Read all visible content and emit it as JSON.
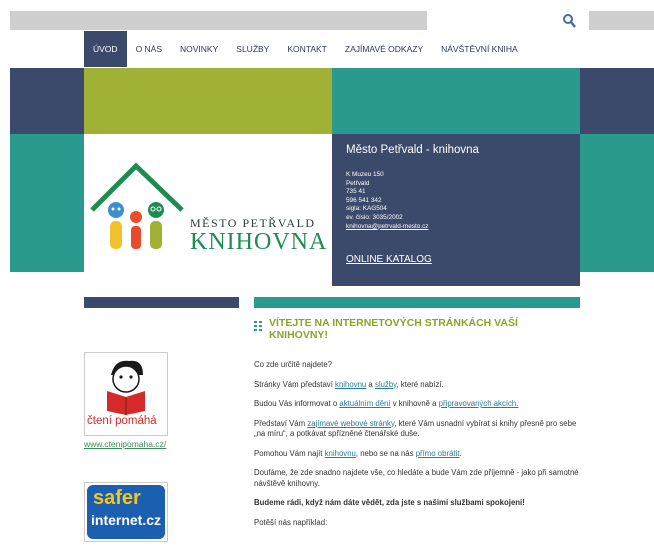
{
  "nav": {
    "items": [
      {
        "label": "ÚVOD",
        "active": true
      },
      {
        "label": "O NÁS"
      },
      {
        "label": "NOVINKY"
      },
      {
        "label": "SLUŽBY"
      },
      {
        "label": "KONTAKT"
      },
      {
        "label": "ZAJÍMAVÉ ODKAZY"
      },
      {
        "label": "NÁVŠTĚVNÍ KNIHA"
      }
    ]
  },
  "search": {
    "placeholder": ""
  },
  "logo": {
    "title": "MĚSTO PETŘVALD",
    "subtitle": "KNIHOVNA"
  },
  "info": {
    "name": "Město Petřvald - knihovna",
    "street": "K Muzeu 150",
    "city": "Petřvald",
    "zip": "735 41",
    "phone": "596 541 342",
    "sigla": "sigla: KAG504",
    "ev": "ev. číslo: 3035/2002",
    "email": "knihovna@petrvald-mesto.cz",
    "katalog": "ONLINE KATALOG"
  },
  "sidebar": {
    "ad1_text": "čtení pomáhá",
    "ad1_link": "www.ctenipomaha.cz/",
    "ad2_line1": "safer",
    "ad2_line2": "internet.cz"
  },
  "main": {
    "heading": "VÍTEJTE NA INTERNETOVÝCH STRÁNKÁCH VAŠÍ KNIHOVNY!",
    "p1": "Co zde určitě najdete?",
    "p2": {
      "a": "Stránky Vám představí ",
      "l1": "knihovnu",
      "b": " a ",
      "l2": "služby",
      "c": ", které nabízí."
    },
    "p3": {
      "a": "Budou Vás informovat o ",
      "l1": "aktuálním dění",
      "b": "  v knihovně a ",
      "l2": "připravovaných akcích."
    },
    "p4": {
      "a": "Představí Vám ",
      "l1": "zajímavé webové stránky",
      "b": ", které Vám usnadní vybírat si knihy přesně pro sebe „na míru“, a potkávat spřízněné čtenářské duše."
    },
    "p5": {
      "a": "Pomohou Vám najít ",
      "l1": "knihovnu",
      "b": ", nebo se na nás ",
      "l2": "přímo obrátit",
      "c": "."
    },
    "p6": "Doufáme, že zde snadno najdete vše, co hledáte a bude Vám zde příjemně - jako při samotné návštěvě knihovny.",
    "p7": "Budeme rádi, když nám dáte vědět, zda jste s našimi službami spokojeni!",
    "p8": "Potěší nás například:"
  },
  "colors": {
    "navy": "#3b4a6b",
    "olive": "#a0b135",
    "teal": "#2a9a8e",
    "heading": "#8aa428",
    "link": "#2a7a9a"
  }
}
